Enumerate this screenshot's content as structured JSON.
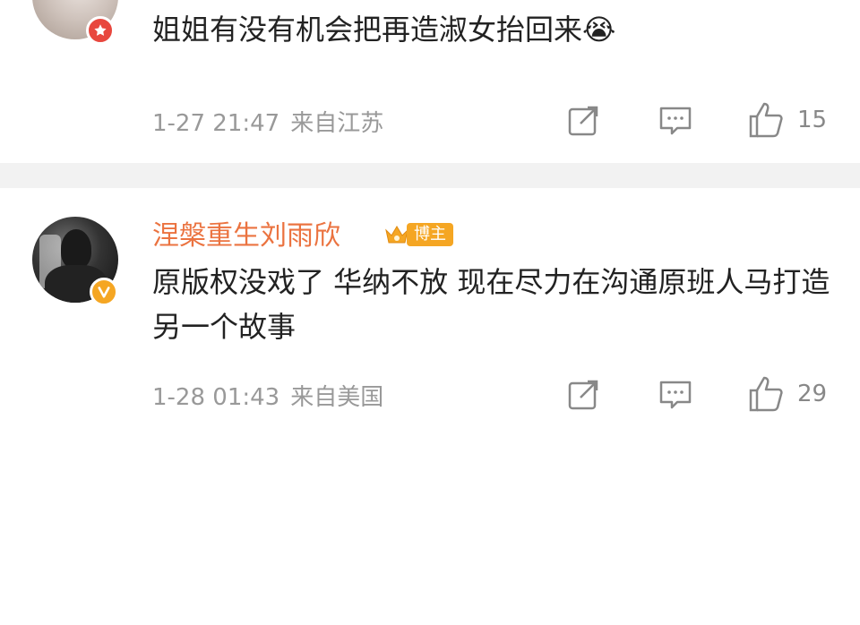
{
  "comments": [
    {
      "text": "姐姐有没有机会把再造淑女抬回来",
      "emoji": "😭",
      "time": "1-27 21:47",
      "location": "来自江苏",
      "likes": "15"
    },
    {
      "username": "涅槃重生刘雨欣",
      "tag_label": "博主",
      "text": "原版权没戏了 华纳不放  现在尽力在沟通原班人马打造另一个故事",
      "time": "1-28 01:43",
      "location": "来自美国",
      "likes": "29"
    }
  ],
  "colors": {
    "username": "#eb7340",
    "meta": "#999999",
    "divider": "#f2f2f2",
    "badge_red": "#e8473e",
    "badge_gold": "#f5a623"
  },
  "icons": [
    "star-badge-icon",
    "verified-badge-icon",
    "crown-icon",
    "share-icon",
    "comment-icon",
    "like-icon"
  ]
}
